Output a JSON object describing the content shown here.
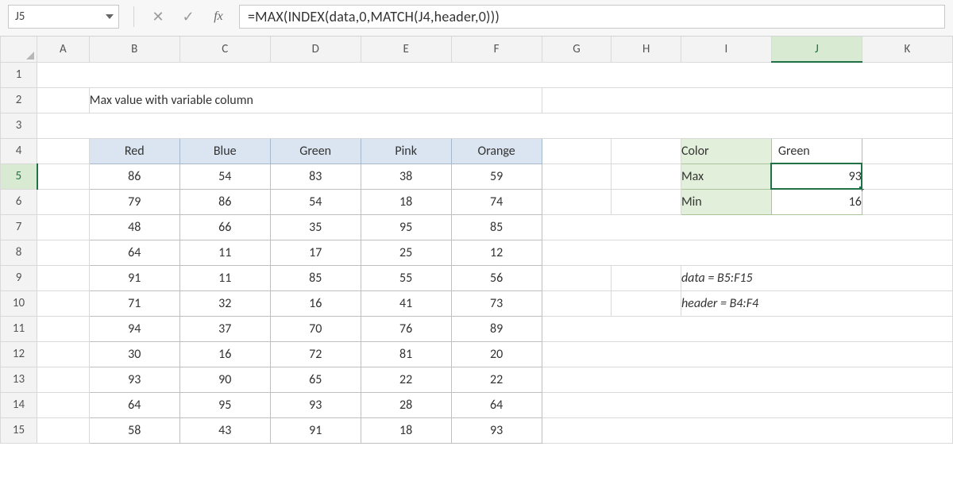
{
  "namebox": {
    "value": "J5"
  },
  "formula_bar": {
    "cancel_icon": "✕",
    "enter_icon": "✓",
    "fx_label": "fx",
    "formula": "=MAX(INDEX(data,0,MATCH(J4,header,0)))"
  },
  "columns": [
    "A",
    "B",
    "C",
    "D",
    "E",
    "F",
    "G",
    "H",
    "I",
    "J",
    "K"
  ],
  "rows": [
    "1",
    "2",
    "3",
    "4",
    "5",
    "6",
    "7",
    "8",
    "9",
    "10",
    "11",
    "12",
    "13",
    "14",
    "15"
  ],
  "selected_col": "J",
  "selected_row": "5",
  "title": "Max value with variable column",
  "data_table": {
    "headers": [
      "Red",
      "Blue",
      "Green",
      "Pink",
      "Orange"
    ],
    "rows": [
      [
        86,
        54,
        83,
        38,
        59
      ],
      [
        79,
        86,
        54,
        18,
        74
      ],
      [
        48,
        66,
        35,
        95,
        85
      ],
      [
        64,
        11,
        17,
        25,
        12
      ],
      [
        91,
        11,
        85,
        55,
        56
      ],
      [
        71,
        32,
        16,
        41,
        73
      ],
      [
        94,
        37,
        70,
        76,
        89
      ],
      [
        30,
        16,
        72,
        81,
        20
      ],
      [
        93,
        90,
        65,
        22,
        22
      ],
      [
        64,
        95,
        93,
        28,
        64
      ],
      [
        58,
        43,
        91,
        18,
        93
      ]
    ]
  },
  "side_table": {
    "color_label": "Color",
    "color_value": "Green",
    "max_label": "Max",
    "max_value": 93,
    "min_label": "Min",
    "min_value": 16
  },
  "notes": {
    "data_def": "data = B5:F15",
    "header_def": "header = B4:F4"
  },
  "chart_data": {
    "type": "table",
    "title": "Max value with variable column",
    "categories": [
      "Red",
      "Blue",
      "Green",
      "Pink",
      "Orange"
    ],
    "series": [
      {
        "name": "row5",
        "values": [
          86,
          54,
          83,
          38,
          59
        ]
      },
      {
        "name": "row6",
        "values": [
          79,
          86,
          54,
          18,
          74
        ]
      },
      {
        "name": "row7",
        "values": [
          48,
          66,
          35,
          95,
          85
        ]
      },
      {
        "name": "row8",
        "values": [
          64,
          11,
          17,
          25,
          12
        ]
      },
      {
        "name": "row9",
        "values": [
          91,
          11,
          85,
          55,
          56
        ]
      },
      {
        "name": "row10",
        "values": [
          71,
          32,
          16,
          41,
          73
        ]
      },
      {
        "name": "row11",
        "values": [
          94,
          37,
          70,
          76,
          89
        ]
      },
      {
        "name": "row12",
        "values": [
          30,
          16,
          72,
          81,
          20
        ]
      },
      {
        "name": "row13",
        "values": [
          93,
          90,
          65,
          22,
          22
        ]
      },
      {
        "name": "row14",
        "values": [
          64,
          95,
          93,
          28,
          64
        ]
      },
      {
        "name": "row15",
        "values": [
          58,
          43,
          91,
          18,
          93
        ]
      }
    ],
    "summary": {
      "color": "Green",
      "max": 93,
      "min": 16
    }
  }
}
